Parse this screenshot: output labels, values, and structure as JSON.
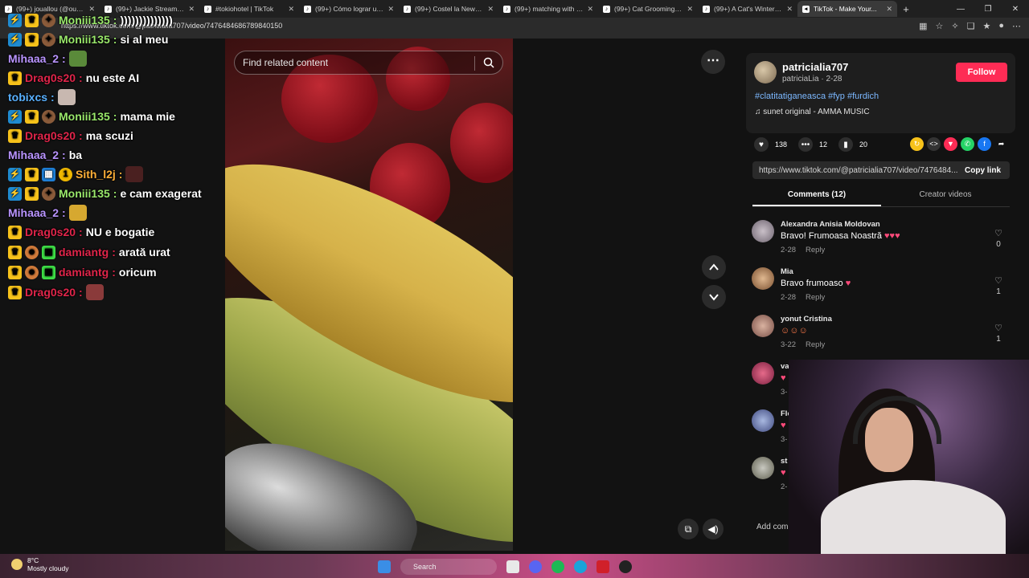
{
  "browser": {
    "tabs": [
      {
        "label": "(99+) jouallou (@ouall..."
      },
      {
        "label": "(99+) Jackie Streamer &..."
      },
      {
        "label": "#tokiohotel | TikTok"
      },
      {
        "label": "(99+) Cómo lograr una..."
      },
      {
        "label": "(99+) Costel la New Rai..."
      },
      {
        "label": "(99+) matching with the..."
      },
      {
        "label": "(99+) Cat Grooming Go..."
      },
      {
        "label": "(99+) A Cat's Winter Ad..."
      },
      {
        "label": "TikTok - Make Your..."
      }
    ],
    "url": "https://www.tiktok.com/@patricialia707/video/7476484686789840150"
  },
  "chat": [
    {
      "user": "Moniii135",
      "msg": "))))))))))))))"
    },
    {
      "user": "Moniii135",
      "msg": "si al meu"
    },
    {
      "user": "Mihaaa_2",
      "msg": ""
    },
    {
      "user": "Drag0s20",
      "msg": "nu este AI"
    },
    {
      "user": "tobixcs",
      "msg": ""
    },
    {
      "user": "Moniii135",
      "msg": "mama mie"
    },
    {
      "user": "Drag0s20",
      "msg": "ma scuzi"
    },
    {
      "user": "Mihaaa_2",
      "msg": "ba"
    },
    {
      "user": "Sith_l2j",
      "msg": ""
    },
    {
      "user": "Moniii135",
      "msg": "e cam exagerat"
    },
    {
      "user": "Mihaaa_2",
      "msg": ""
    },
    {
      "user": "Drag0s20",
      "msg": "NU e bogatie"
    },
    {
      "user": "damiantg",
      "msg": "arată urat"
    },
    {
      "user": "damiantg",
      "msg": "oricum"
    },
    {
      "user": "Drag0s20",
      "msg": ""
    }
  ],
  "video": {
    "search_placeholder": "Find related content"
  },
  "post": {
    "username": "patricialia707",
    "handle_date": "patriciaLia · 2-28",
    "follow_label": "Follow",
    "hashtags": "#clatitatiganeasca #fyp #furdich",
    "sound": "sunet original - AMMA MUSIC",
    "likes": "138",
    "comments": "12",
    "saves": "20",
    "link": "https://www.tiktok.com/@patricialia707/video/7476484...",
    "copy_label": "Copy link",
    "tab_comments": "Comments (12)",
    "tab_creator": "Creator videos",
    "add_comment": "Add com"
  },
  "comments": [
    {
      "name": "Alexandra Anisia Moldovan",
      "text": "Bravo! Frumoasa Noastră",
      "date": "2-28",
      "reply": "Reply",
      "likes": "0"
    },
    {
      "name": "Mia",
      "text": "Bravo frumoaso",
      "date": "2-28",
      "reply": "Reply",
      "likes": "1"
    },
    {
      "name": "yonut Cristina",
      "text": "",
      "date": "3-22",
      "reply": "Reply",
      "likes": "1"
    },
    {
      "name": "va",
      "text": "",
      "date": "3-",
      "reply": "",
      "likes": ""
    },
    {
      "name": "Flo",
      "text": "",
      "date": "3-",
      "reply": "",
      "likes": ""
    },
    {
      "name": "st",
      "text": "",
      "date": "2-",
      "reply": "",
      "likes": ""
    }
  ],
  "taskbar": {
    "temp": "8°C",
    "weather": "Mostly cloudy",
    "search": "Search"
  },
  "colors": {
    "follow": "#fe2c55",
    "hashtag": "#7cb8ff",
    "crown_badge": "#f7c21a"
  }
}
